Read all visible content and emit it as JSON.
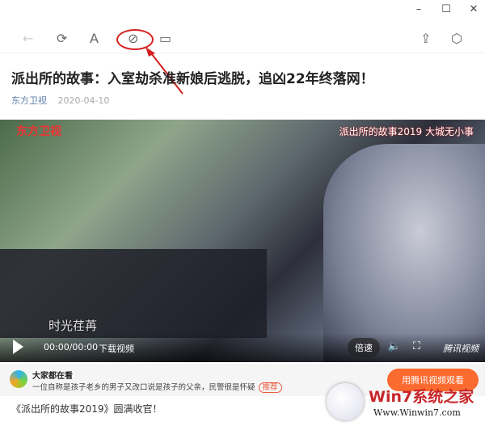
{
  "window": {
    "minimize": "–",
    "maximize": "☐",
    "close": "✕"
  },
  "toolbar": {
    "back": "←",
    "refresh": "⟳",
    "font": "A",
    "link": "⊘",
    "reader": "▭",
    "share": "⇪",
    "cube": "⬡"
  },
  "article": {
    "title": "派出所的故事：入室劫杀准新娘后逃脱，追凶22年终落网！",
    "source": "东方卫视",
    "date": "2020-04-10",
    "body": "《派出所的故事2019》圆满收官！"
  },
  "video": {
    "channel_logo": "东方卫视",
    "watermark": "派出所的故事2019 大城无小事",
    "caption": "时光荏苒",
    "time": "00:00/00:00",
    "download": "下载视频",
    "speed": "倍速",
    "volume": "🔈",
    "fullscreen": "⛶",
    "brand": "腾讯视频"
  },
  "recommend": {
    "title": "大家都在看",
    "desc": "一位自称是孩子老乡的男子又改口说是孩子的父亲，民警很是怀疑",
    "tag": "推荐",
    "button": "用腾讯视频观看"
  },
  "watermark": {
    "name": "Win7系统之家",
    "url": "Www.Winwin7.com"
  }
}
